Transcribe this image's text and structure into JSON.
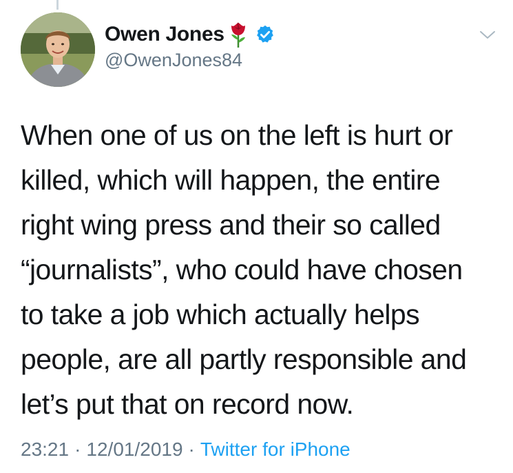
{
  "tweet": {
    "author": {
      "display_name": "Owen Jones",
      "handle": "@OwenJones84",
      "verified": true,
      "name_emoji": "rose-icon"
    },
    "text": "When one of us on the left is hurt or\nkilled, which will happen, the entire\nright wing press and their so called\n“journalists”, who could have chosen\nto take a job which actually helps\npeople, are all partly responsible and\nlet’s put that on record now.",
    "time": "23:21",
    "date": "12/01/2019",
    "separator": "·",
    "source": "Twitter for iPhone"
  },
  "colors": {
    "text_primary": "#14171a",
    "text_secondary": "#657786",
    "accent_blue": "#1da1f2",
    "rose_red": "#c8102e"
  },
  "icons": {
    "menu": "chevron-down-icon",
    "verified": "verified-badge-icon"
  }
}
